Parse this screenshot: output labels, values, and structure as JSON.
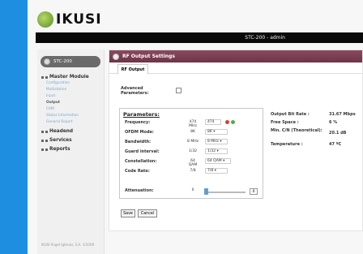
{
  "header": {
    "logo_text": "IKUSI",
    "topbar_text": "STC-200 - admin"
  },
  "sidebar": {
    "device_label": "STC-200",
    "items": [
      {
        "label": "Master Module",
        "type": "head"
      },
      {
        "label": "Configuration",
        "type": "sub"
      },
      {
        "label": "Multistation",
        "type": "sub"
      },
      {
        "label": "Input",
        "type": "sub"
      },
      {
        "label": "Output",
        "type": "sub",
        "active": true
      },
      {
        "label": "CAM",
        "type": "sub"
      },
      {
        "label": "Status Information",
        "type": "sub"
      },
      {
        "label": "General Report",
        "type": "sub"
      },
      {
        "label": "Headend",
        "type": "head"
      },
      {
        "label": "Services",
        "type": "head"
      },
      {
        "label": "Reports",
        "type": "head"
      }
    ],
    "footer": "IKUSI Ángel Iglesias, S.A. ©2009"
  },
  "panel": {
    "title": "RF Output Settings",
    "tab": "RF Output",
    "advanced_label": "Advanced Parameters:",
    "params_title": "Parameters:",
    "params": [
      {
        "label": "Frequency:",
        "value": "474 MHz",
        "selected": "474"
      },
      {
        "label": "OFDM Mode:",
        "value": "8K",
        "selected": "8K"
      },
      {
        "label": "Bandwidth:",
        "value": "8 MHz",
        "selected": "8 MHz"
      },
      {
        "label": "Guard interval:",
        "value": "1/32",
        "selected": "1/32"
      },
      {
        "label": "Constellation:",
        "value": "64 QAM",
        "selected": "64 QAM"
      },
      {
        "label": "Code Rate:",
        "value": "7/8",
        "selected": "7/8"
      },
      {
        "label": "Attenuation:",
        "value": "0",
        "selected": "0"
      }
    ],
    "stats": [
      {
        "label": "Output Bit Rate :",
        "value": "31.67 Mbps"
      },
      {
        "label": "Free Space :",
        "value": "6 %"
      },
      {
        "label": "Min. C/N (Theoretical):",
        "value": "20.1 dB"
      },
      {
        "label": "Temperature :",
        "value": "47 ºC"
      }
    ],
    "buttons": {
      "save": "Save",
      "cancel": "Cancel"
    }
  },
  "colors": {
    "left_strip": "#1e8fe0",
    "panel_header": "#7a3d52",
    "topbar": "#0a0a0a",
    "status_red": "#d8403a",
    "status_green": "#4caf50"
  }
}
